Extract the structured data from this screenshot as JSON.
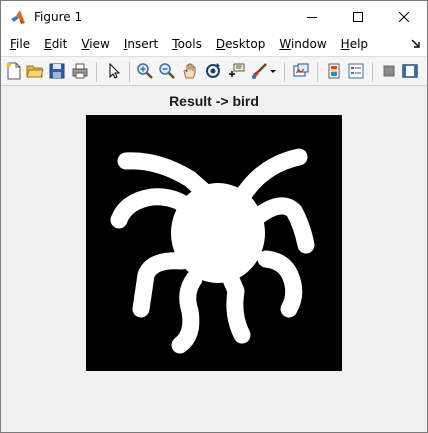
{
  "window": {
    "title": "Figure 1",
    "app_icon": "matlab-icon",
    "controls": [
      "minimize-icon",
      "maximize-icon",
      "close-icon"
    ]
  },
  "menubar": {
    "items": [
      {
        "label": "File",
        "key": "F"
      },
      {
        "label": "Edit",
        "key": "E"
      },
      {
        "label": "View",
        "key": "V"
      },
      {
        "label": "Insert",
        "key": "I"
      },
      {
        "label": "Tools",
        "key": "T"
      },
      {
        "label": "Desktop",
        "key": "D"
      },
      {
        "label": "Window",
        "key": "W"
      },
      {
        "label": "Help",
        "key": "H"
      }
    ],
    "dock_icon": "dock-arrow-icon"
  },
  "toolbar": {
    "icons": [
      "new-figure-icon",
      "open-file-icon",
      "save-icon",
      "print-icon",
      "pointer-icon",
      "zoom-in-icon",
      "zoom-out-icon",
      "pan-icon",
      "rotate-3d-icon",
      "data-cursor-icon",
      "brush-icon",
      "brush-dropdown-icon",
      "link-plot-icon",
      "insert-colorbar-icon",
      "insert-legend-icon",
      "hide-plot-tools-icon",
      "show-plot-tools-icon"
    ]
  },
  "figure": {
    "axes_title": "Result -> bird",
    "image_background": "#000000",
    "image_foreground": "#ffffff",
    "image_content": "binary-silhouette"
  }
}
